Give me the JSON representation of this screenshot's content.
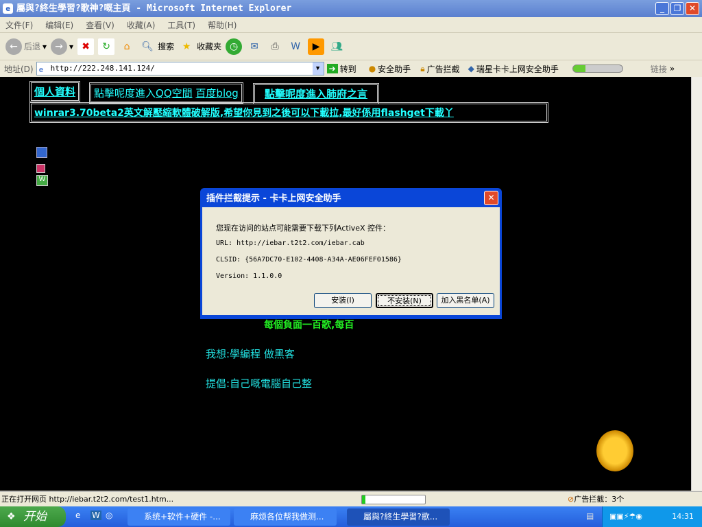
{
  "window": {
    "title": "屬與?終生學習?歌神?嘅主頁 - Microsoft Internet Explorer",
    "minimize": "_",
    "restore": "❐",
    "close": "✕"
  },
  "menu": [
    "文件(F)",
    "编辑(E)",
    "查看(V)",
    "收藏(A)",
    "工具(T)",
    "帮助(H)"
  ],
  "toolbar": {
    "back": "后退",
    "search": "搜索",
    "favorites": "收藏夹"
  },
  "address": {
    "label": "地址(D)",
    "url": "http://222.248.141.124/",
    "go": "转到",
    "safety": "安全助手",
    "adblock": "广告拦截",
    "rising": "瑞星卡卡上网安全助手",
    "links": "链接"
  },
  "page": {
    "profile": "個人資料",
    "qq_prefix": "點擊呢度進入",
    "qq_link": "QQ空間",
    "baidu_link": "百度blog",
    "lungs_link": "點擊呢度進入肺府之言",
    "winrar_link": "winrar3.70beta2英文解壓縮軟體破解版,希望你見到之後可以下載拉,最好係用flashget下載丫",
    "green_line": "每個負面一百歌,每百",
    "wish": "我想:學編程 做黑客",
    "advocate": "提倡:自己嘅電腦自己整"
  },
  "dialog": {
    "title": "插件拦截提示 - 卡卡上网安全助手",
    "message": "您现在访问的站点可能需要下载下列ActiveX 控件：",
    "url": "URL: http://iebar.t2t2.com/iebar.cab",
    "clsid": "CLSID: {56A7DC70-E102-4408-A34A-AE06FEF01586}",
    "version": "Version: 1.1.0.0",
    "install": "安装(I)",
    "dont_install": "不安装(N)",
    "blacklist": "加入黑名单(A)"
  },
  "status": {
    "text": "正在打开网页 http://iebar.t2t2.com/test1.htm...",
    "progress": 0.05,
    "adblock": "广告拦截：3个"
  },
  "taskbar": {
    "start": "开始",
    "tasks": [
      "系统+软件+硬件 -...",
      "麻烦各位帮我做测...",
      "屬與?終生學習?歌..."
    ],
    "clock": "14:31"
  }
}
